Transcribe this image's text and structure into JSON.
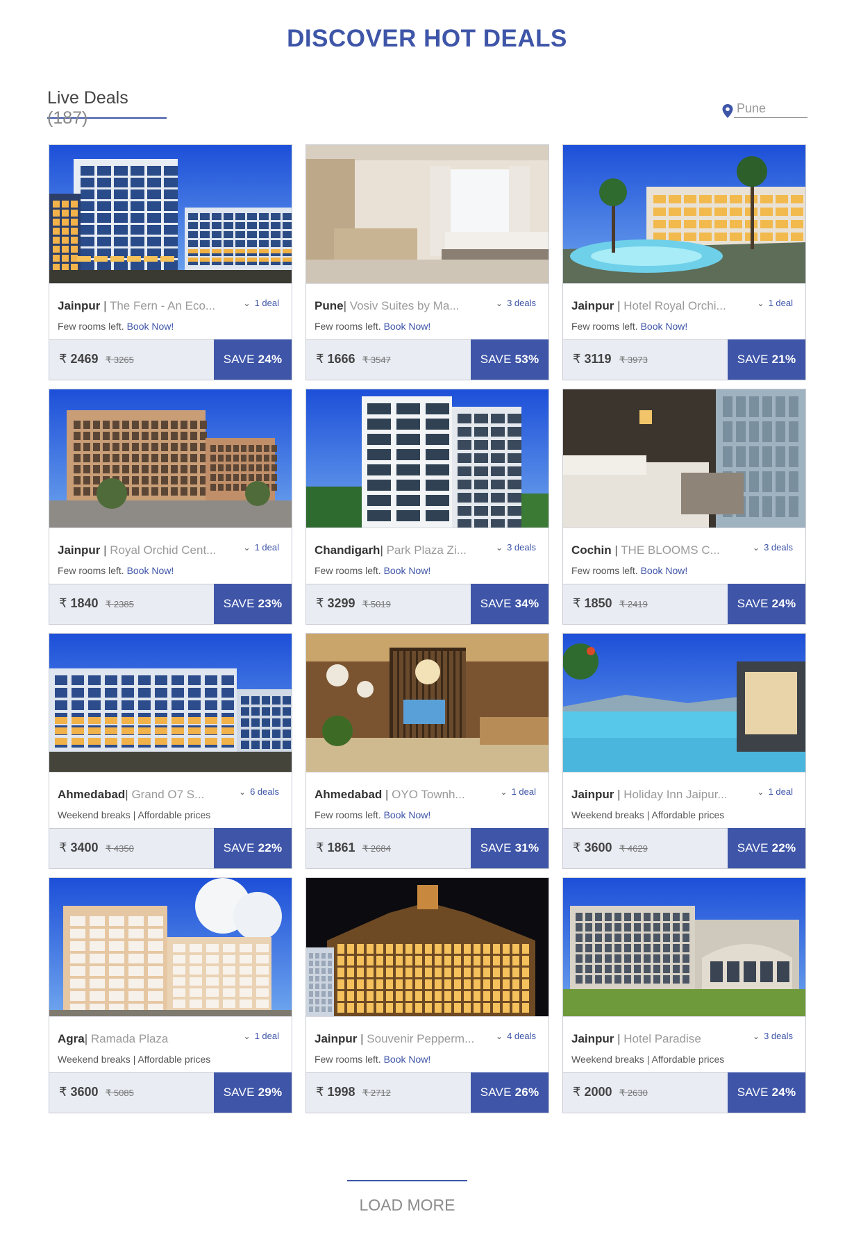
{
  "page": {
    "title": "DISCOVER HOT DEALS"
  },
  "live_deals": {
    "label": "Live Deals",
    "count": "(187)"
  },
  "location": {
    "placeholder": "Pune",
    "icon": "location-pin-icon"
  },
  "currency_symbol": "₹",
  "save_prefix": "SAVE",
  "book_now": "Book Now!",
  "deals": [
    {
      "city": "Jainpur",
      "separator": " | ",
      "hotel": "The Fern - An Eco...",
      "deals": "1 deal",
      "note": "Few rooms left.",
      "book": true,
      "price": "2469",
      "old_price": "3265",
      "save": "24%"
    },
    {
      "city": "Pune",
      "separator": "| ",
      "hotel": "Vosiv Suites by Ma...",
      "deals": "3 deals",
      "note": "Few rooms left.",
      "book": true,
      "price": "1666",
      "old_price": "3547",
      "save": "53%"
    },
    {
      "city": "Jainpur",
      "separator": " | ",
      "hotel": "Hotel Royal Orchi...",
      "deals": "1 deal",
      "note": "Few rooms left.",
      "book": true,
      "price": "3119",
      "old_price": "3973",
      "save": "21%"
    },
    {
      "city": "Jainpur",
      "separator": " | ",
      "hotel": "Royal Orchid Cent...",
      "deals": "1 deal",
      "note": "Few rooms left.",
      "book": true,
      "price": "1840",
      "old_price": "2385",
      "save": "23%"
    },
    {
      "city": "Chandigarh",
      "separator": "| ",
      "hotel": "Park Plaza Zi...",
      "deals": "3 deals",
      "note": "Few rooms left.",
      "book": true,
      "price": "3299",
      "old_price": "5019",
      "save": "34%"
    },
    {
      "city": "Cochin",
      "separator": " | ",
      "hotel": "THE BLOOMS C...",
      "deals": "3 deals",
      "note": "Few rooms left.",
      "book": true,
      "price": "1850",
      "old_price": "2419",
      "save": "24%"
    },
    {
      "city": "Ahmedabad",
      "separator": "| ",
      "hotel": "Grand O7 S...",
      "deals": "6 deals",
      "note": "Weekend breaks | Affordable prices",
      "book": false,
      "price": "3400",
      "old_price": "4350",
      "save": "22%"
    },
    {
      "city": "Ahmedabad",
      "separator": " | ",
      "hotel": "OYO Townh...",
      "deals": "1 deal",
      "note": "Few rooms left.",
      "book": true,
      "price": "1861",
      "old_price": "2684",
      "save": "31%"
    },
    {
      "city": "Jainpur",
      "separator": " | ",
      "hotel": "Holiday Inn Jaipur...",
      "deals": "1 deal",
      "note": "Weekend breaks | Affordable prices",
      "book": false,
      "price": "3600",
      "old_price": "4629",
      "save": "22%"
    },
    {
      "city": "Agra",
      "separator": "| ",
      "hotel": "Ramada Plaza",
      "deals": "1 deal",
      "note": "Weekend breaks | Affordable prices",
      "book": false,
      "price": "3600",
      "old_price": "5085",
      "save": "29%"
    },
    {
      "city": "Jainpur",
      "separator": " | ",
      "hotel": "Souvenir Pepperm...",
      "deals": "4 deals",
      "note": "Few rooms left.",
      "book": true,
      "price": "1998",
      "old_price": "2712",
      "save": "26%"
    },
    {
      "city": "Jainpur",
      "separator": " | ",
      "hotel": "Hotel Paradise",
      "deals": "3 deals",
      "note": "Weekend breaks | Affordable prices",
      "book": false,
      "price": "2000",
      "old_price": "2630",
      "save": "24%"
    }
  ],
  "load_more": "LOAD MORE",
  "colors": {
    "accent": "#3e55a8",
    "price_bar": "#e9ecf3"
  }
}
